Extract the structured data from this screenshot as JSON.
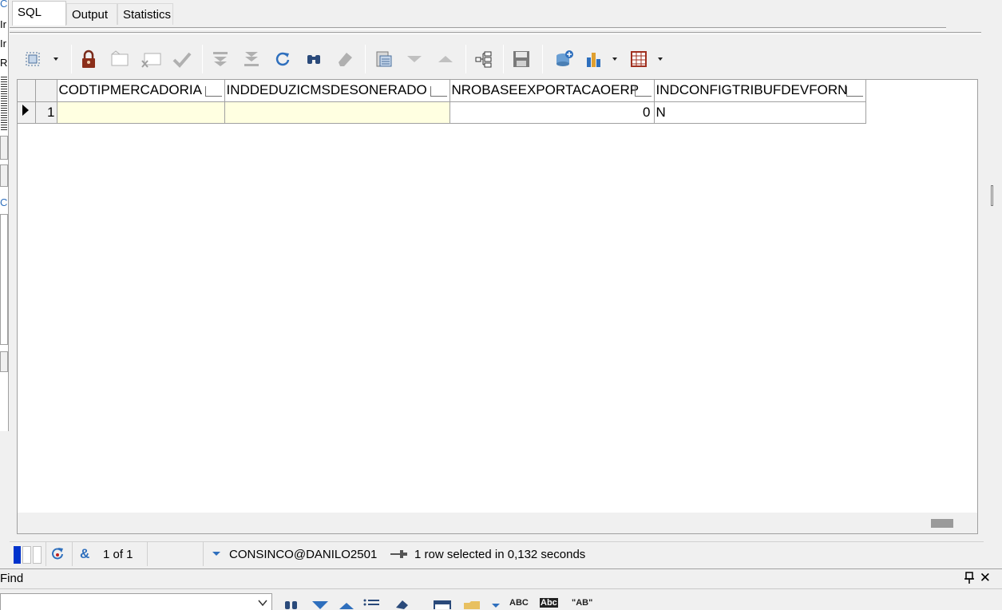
{
  "tabs": [
    {
      "label": "SQL",
      "active": true
    },
    {
      "label": "Output",
      "active": false
    },
    {
      "label": "Statistics",
      "active": false
    }
  ],
  "toolbar": {
    "icons": [
      "select-rect-icon",
      "lock-icon",
      "new-record-icon",
      "cancel-record-icon",
      "post-record-icon",
      "first-record-icon",
      "last-record-icon",
      "refresh-icon",
      "find-icon",
      "eraser-icon",
      "query-by-example-icon",
      "next-icon",
      "previous-icon",
      "explain-plan-icon",
      "save-icon",
      "export-data-icon",
      "chart-icon",
      "grid-view-icon"
    ]
  },
  "grid": {
    "columns": [
      "CODTIPMERCADORIA",
      "INDDEDUZICMSDESONERADO",
      "NROBASEEXPORTACAOERP",
      "INDCONFIGTRIBUFDEVFORN"
    ],
    "rows": [
      {
        "num": "1",
        "cells": [
          "",
          "",
          "0",
          "N"
        ]
      }
    ]
  },
  "status": {
    "record_position": "1 of 1",
    "connection": "CONSINCO@DANILO2501",
    "message": "1 row selected in 0,132 seconds"
  },
  "find_panel": {
    "title": "Find",
    "pin_icon": "pin-icon",
    "close_icon": "close-icon",
    "close_glyph": "✕",
    "tool_labels": [
      "ABC",
      "Abc",
      "\"AB\""
    ]
  },
  "colors": {
    "accent": "#2e6fbd",
    "selection_yellow": "#ffffe1",
    "status_blue": "#0033cc"
  }
}
